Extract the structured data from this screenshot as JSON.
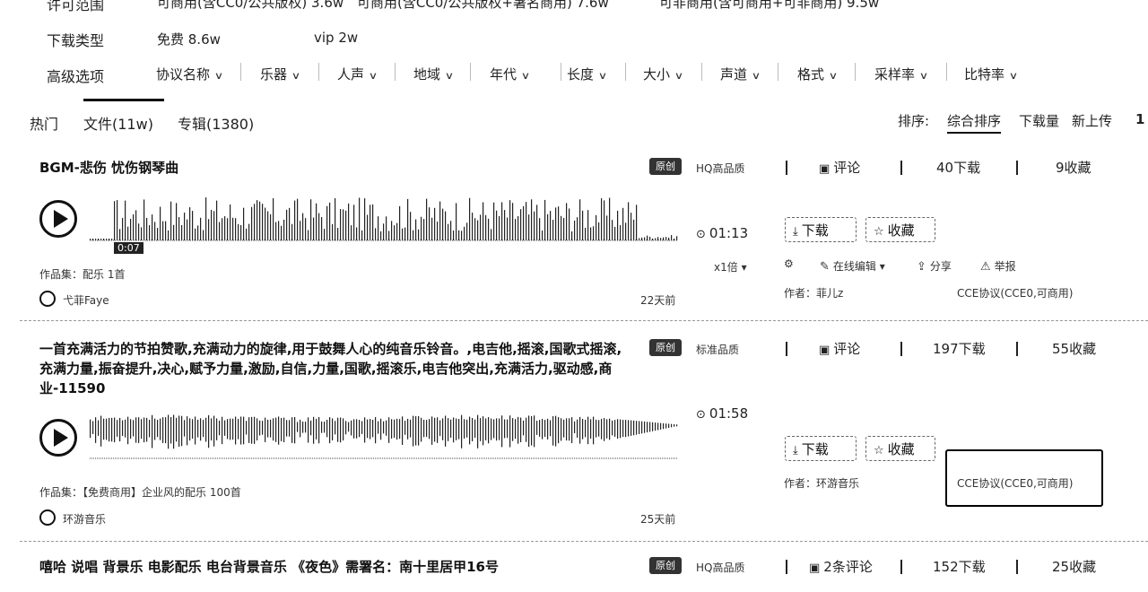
{
  "filters": {
    "license": {
      "label": "许可范围",
      "options": [
        "可商用(含CC0/公共版权)  3.6w",
        "可商用(含CC0/公共版权+署名商用)  7.6w",
        "可非商用(含可商用+可非商用)  9.5w"
      ]
    },
    "download_type": {
      "label": "下载类型",
      "options": [
        "免费  8.6w",
        "vip  2w"
      ]
    },
    "advanced": {
      "label": "高级选项",
      "items": [
        "协议名称",
        "乐器",
        "人声",
        "地域",
        "年代",
        "长度",
        "大小",
        "声道",
        "格式",
        "采样率",
        "比特率"
      ]
    }
  },
  "tabs": [
    "热门",
    "文件(11w)",
    "专辑(1380)"
  ],
  "sort": {
    "label": "排序:",
    "options": [
      "综合排序",
      "下载量",
      "新上传"
    ],
    "page": "1"
  },
  "items": [
    {
      "title": "BGM-悲伤 忧伤钢琴曲",
      "badge": "原创",
      "quality": "HQ高品质",
      "comments": "评论",
      "downloads": "40下载",
      "favorites": "9收藏",
      "duration": "01:13",
      "progress_label": "0:07",
      "speed": "x1倍",
      "download_label": "下载",
      "favorite_label": "收藏",
      "collection": "作品集：配乐 1首",
      "author_name": "弋菲Faye",
      "age": "22天前",
      "tools": [
        "在线编辑",
        "分享",
        "举报"
      ],
      "creator": "作者：菲儿z",
      "license": "CCE协议(CCE0,可商用)"
    },
    {
      "title": "一首充满活力的节拍赞歌,充满动力的旋律,用于鼓舞人心的纯音乐铃音。,电吉他,摇滚,国歌式摇滚,充满力量,振奋提升,决心,赋予力量,激励,自信,力量,国歌,摇滚乐,电吉他突出,充满活力,驱动感,商业-11590",
      "badge": "原创",
      "quality": "标准品质",
      "comments": "评论",
      "downloads": "197下载",
      "favorites": "55收藏",
      "duration": "01:58",
      "download_label": "下载",
      "favorite_label": "收藏",
      "collection": "作品集：【免费商用】企业风的配乐 100首",
      "author_name": "环游音乐",
      "age": "25天前",
      "creator": "作者：环游音乐",
      "license": "CCE协议(CCE0,可商用)"
    },
    {
      "title": "嘻哈 说唱 背景乐 电影配乐 电台背景音乐 《夜色》需署名：南十里居甲16号",
      "badge": "原创",
      "quality": "HQ高品质",
      "comments": "2条评论",
      "downloads": "152下载",
      "favorites": "25收藏"
    }
  ]
}
